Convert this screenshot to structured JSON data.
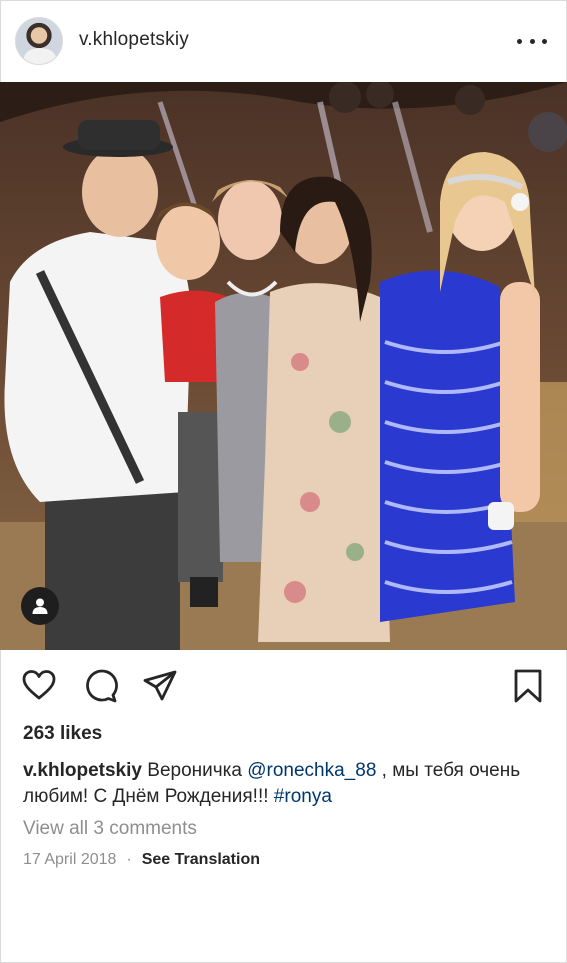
{
  "post": {
    "username": "v.khlopetskiy",
    "likes": "263 likes",
    "caption": {
      "username": "v.khlopetskiy",
      "text_before": "Вероничка ",
      "mention": "@ronechka_88",
      "text_after": " , мы тебя очень любим! С Днём Рождения!!! ",
      "hashtag": "#ronya"
    },
    "view_comments": "View all 3 comments",
    "date": "17 April 2018",
    "separator": "·",
    "see_translation": "See Translation"
  },
  "icons": {
    "more": "more-options-icon",
    "tag": "tagged-user-icon",
    "like": "heart-icon",
    "comment": "comment-icon",
    "share": "share-icon",
    "save": "bookmark-icon"
  },
  "colors": {
    "text": "#262626",
    "secondary": "#8e8e8e",
    "link": "#00376b",
    "border": "#dbdbdb"
  }
}
